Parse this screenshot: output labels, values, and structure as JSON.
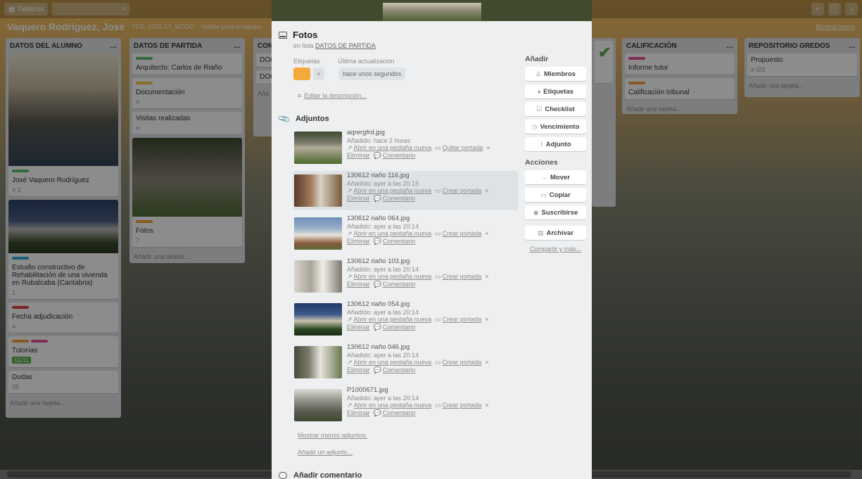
{
  "topbar": {
    "boards_label": "Tableros"
  },
  "board": {
    "title": "Vaquero Rodriguez, José",
    "subtitle": "TFG_2016-17_MCOC",
    "visibility": "Visible para el equipo",
    "menu": "Mostrar menú"
  },
  "lists": [
    {
      "title": "DATOS DEL ALUMNO",
      "cards": [
        {
          "text": "José Vaquero Rodríguez",
          "badge": "≡ 1"
        },
        {
          "text": "Estudio constructivo de Rehabilitación de una vivienda en Rubalcaba (Cantabria)",
          "badge": "1"
        },
        {
          "text": "Fecha adjudicación",
          "badge": "≡"
        },
        {
          "text": "Tutorías",
          "badge": "11/11"
        },
        {
          "text": "Dudas",
          "badge": "38"
        }
      ],
      "add": "Añadir una tarjeta..."
    },
    {
      "title": "DATOS DE PARTIDA",
      "cards": [
        {
          "text": "Arquitecto: Carlos de Riaño",
          "badge": ""
        },
        {
          "text": "Documentación",
          "badge": "≡"
        },
        {
          "text": "Visitas realizadas",
          "badge": "≡"
        },
        {
          "text": "Fotos",
          "badge": "7"
        }
      ],
      "add": "Añadir una tarjeta..."
    },
    {
      "title": "CON",
      "cards": [
        {
          "text": "DOC",
          "badge": ""
        },
        {
          "text": "DOC",
          "badge": ""
        }
      ],
      "add": "Aña"
    },
    {
      "title": "CALIFICACIÓN",
      "cards": [
        {
          "text": "Informe tutor",
          "badge": ""
        },
        {
          "text": "Calificación tribunal",
          "badge": ""
        }
      ],
      "add": "Añadir una tarjeta..."
    },
    {
      "title": "REPOSITORIO GREDOS",
      "cards": [
        {
          "text": "Propuesto",
          "badge": "≡ 0/2"
        }
      ],
      "add": "Añadir una tarjeta..."
    }
  ],
  "modal": {
    "title": "Fotos",
    "in_list_prefix": "en lista",
    "list_name": "DATOS DE PARTIDA",
    "labels_heading": "Etiquetas",
    "updated_heading": "Última actualización",
    "updated_value": "hace unos segundos",
    "tag_color": "#f5a93a",
    "edit_description": "Editar la descripción...",
    "attachments_heading": "Adjuntos",
    "attachments": [
      {
        "name": "aqrergfrd.jpg",
        "added": "Añadido: hace 2 horas",
        "open": "Abrir en una pestaña nueva",
        "cover": "Quitar portada",
        "delete": "Eliminar",
        "comment": "Comentario"
      },
      {
        "name": "130612 riaño 116.jpg",
        "added": "Añadido: ayer a las 20:15",
        "open": "Abrir en una pestaña nueva",
        "cover": "Crear portada",
        "delete": "Eliminar",
        "comment": "Comentario"
      },
      {
        "name": "130612 riaño 064.jpg",
        "added": "Añadido: ayer a las 20:14",
        "open": "Abrir en una pestaña nueva",
        "cover": "Crear portada",
        "delete": "Eliminar",
        "comment": "Comentario"
      },
      {
        "name": "130612 riaño 103.jpg",
        "added": "Añadido: ayer a las 20:14",
        "open": "Abrir en una pestaña nueva",
        "cover": "Crear portada",
        "delete": "Eliminar",
        "comment": "Comentario"
      },
      {
        "name": "130612 riaño 054.jpg",
        "added": "Añadido: ayer a las 20:14",
        "open": "Abrir en una pestaña nueva",
        "cover": "Crear portada",
        "delete": "Eliminar",
        "comment": "Comentario"
      },
      {
        "name": "130612 riaño 046.jpg",
        "added": "Añadido: ayer a las 20:14",
        "open": "Abrir en una pestaña nueva",
        "cover": "Crear portada",
        "delete": "Eliminar",
        "comment": "Comentario"
      },
      {
        "name": "P1000671.jpg",
        "added": "Añadido: ayer a las 20:14",
        "open": "Abrir en una pestaña nueva",
        "cover": "Crear portada",
        "delete": "Eliminar",
        "comment": "Comentario"
      }
    ],
    "show_fewer": "Mostrar menos adjuntos.",
    "add_attachment": "Añadir un adjunto...",
    "add_comment_heading": "Añadir comentario",
    "sidebar": {
      "add_heading": "Añadir",
      "members": "Miembros",
      "labels": "Etiquetas",
      "checklist": "Checklist",
      "due": "Vencimiento",
      "attachment": "Adjunto",
      "actions_heading": "Acciones",
      "move": "Mover",
      "copy": "Copiar",
      "subscribe": "Suscribirse",
      "archive": "Archivar",
      "share": "Compartir y más..."
    }
  }
}
